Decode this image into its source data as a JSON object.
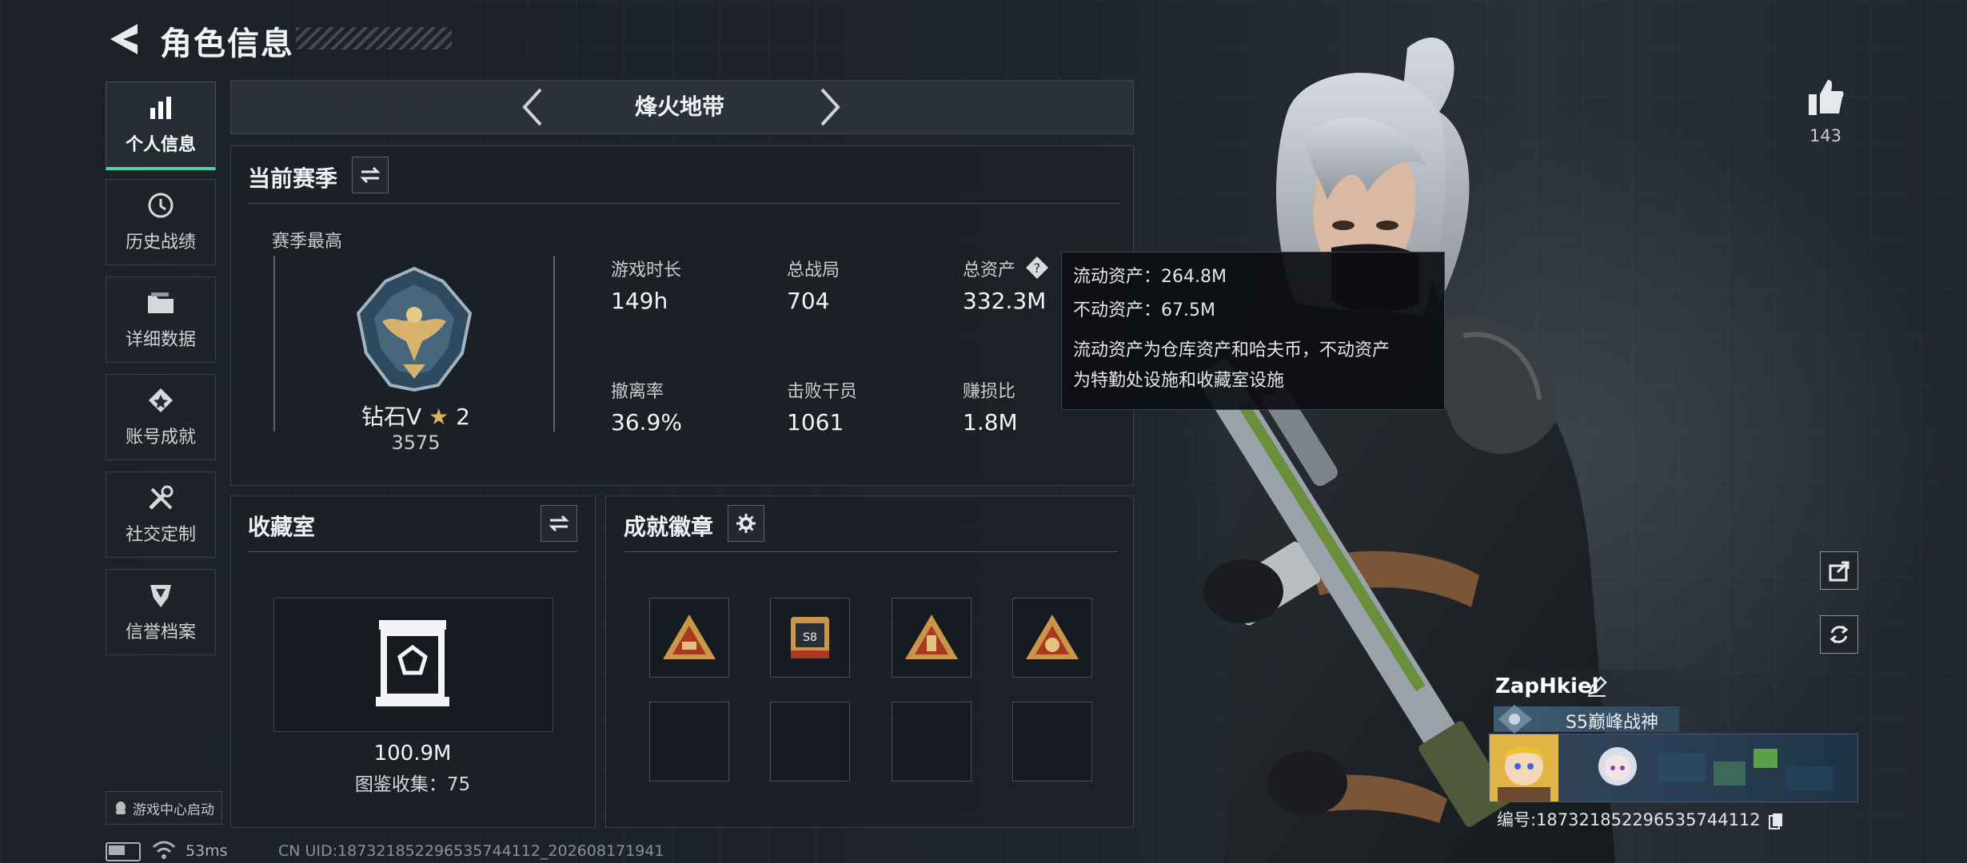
{
  "header": {
    "title": "角色信息"
  },
  "sidebar": {
    "items": [
      {
        "label": "个人信息"
      },
      {
        "label": "历史战绩"
      },
      {
        "label": "详细数据"
      },
      {
        "label": "账号成就"
      },
      {
        "label": "社交定制"
      },
      {
        "label": "信誉档案"
      }
    ],
    "game_center_label": "游戏中心启动"
  },
  "mode_selector": {
    "label": "烽火地带"
  },
  "season": {
    "title": "当前赛季",
    "best_label": "赛季最高",
    "rank_name": "钻石V",
    "rank_stars": "2",
    "rank_points": "3575",
    "stats": [
      {
        "label": "游戏时长",
        "value": "149h"
      },
      {
        "label": "总战局",
        "value": "704"
      },
      {
        "label": "总资产",
        "value": "332.3M"
      },
      {
        "label": "撤离率",
        "value": "36.9%"
      },
      {
        "label": "击败干员",
        "value": "1061"
      },
      {
        "label": "赚损比",
        "value": "1.8M"
      }
    ]
  },
  "tooltip": {
    "liquid": "流动资产：264.8M",
    "fixed": "不动资产：67.5M",
    "desc_line1": "流动资产为仓库资产和哈夫币，不动资产",
    "desc_line2": "为特勤处设施和收藏室设施"
  },
  "collection": {
    "title": "收藏室",
    "value": "100.9M",
    "catalog": "图鉴收集：75"
  },
  "badges": {
    "title": "成就徽章",
    "slot2_text": "S8"
  },
  "likes": {
    "count": "143"
  },
  "profile": {
    "name": "ZapHkiel",
    "season_title": "S5巅峰战神",
    "id_text": "编号:187321852296535744112"
  },
  "status": {
    "ping": "53ms",
    "uid": "CN UID:187321852296535744112_202608171941"
  },
  "colors": {
    "accent": "#4fd1a5",
    "badge_gold": "#c9964a",
    "badge_red": "#a9381f"
  }
}
